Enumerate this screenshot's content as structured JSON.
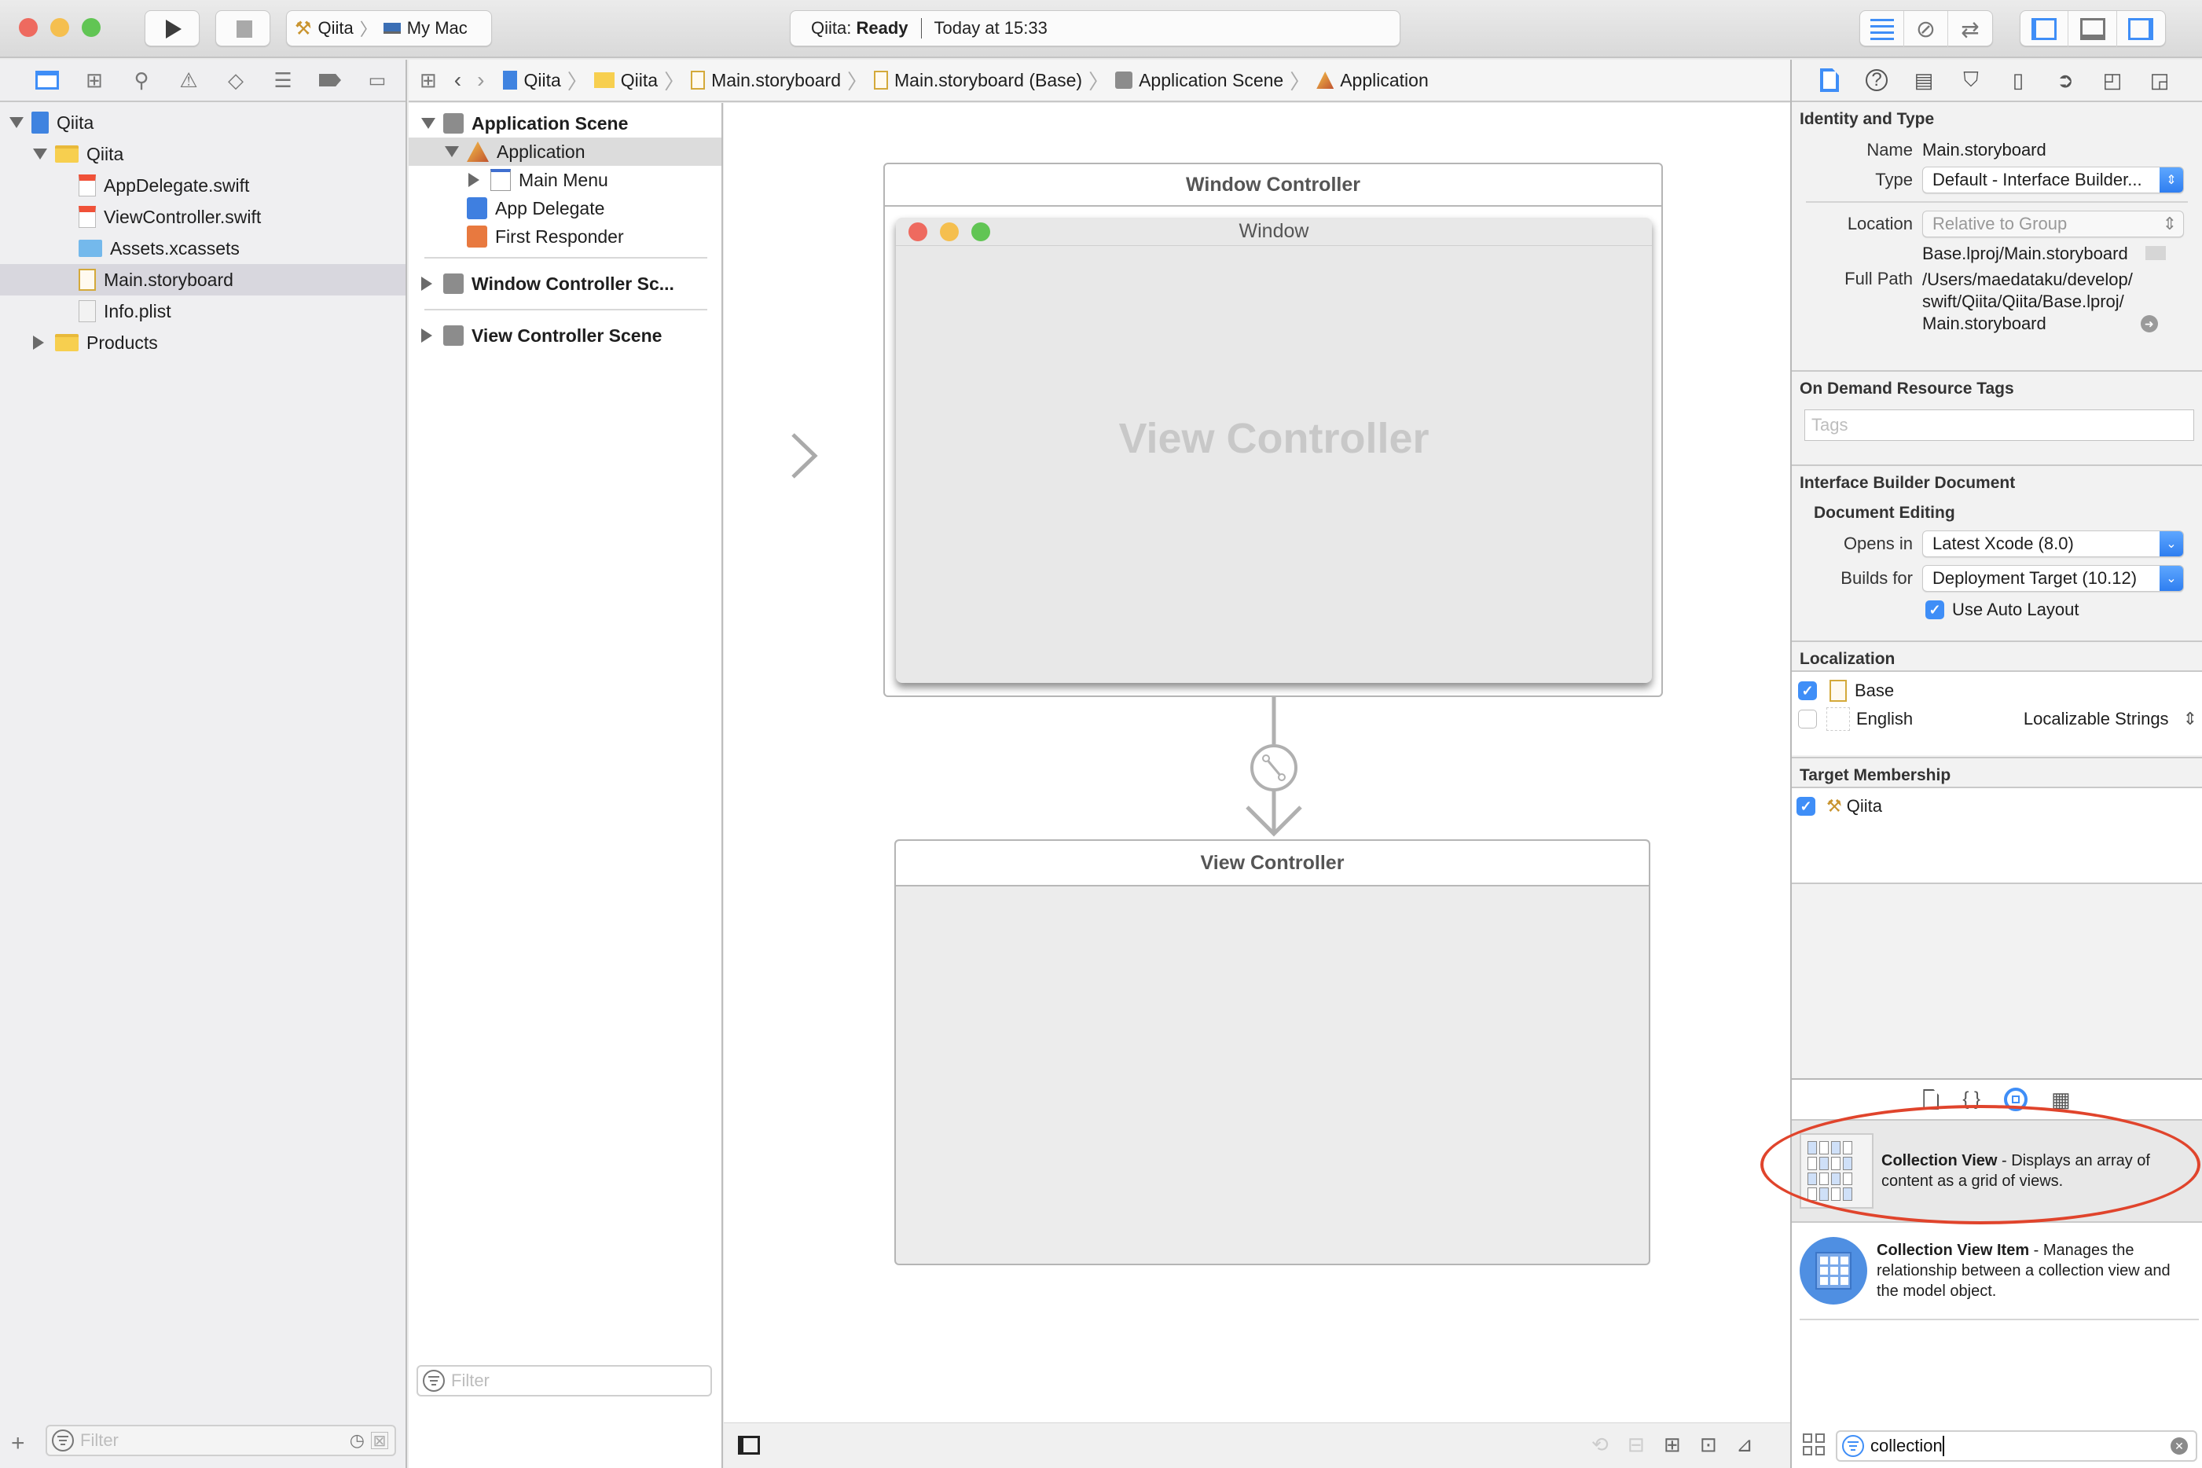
{
  "toolbar": {
    "run_icon": "play-icon",
    "stop_icon": "stop-icon",
    "scheme": {
      "project": "Qiita",
      "destination": "My Mac"
    },
    "status": {
      "project": "Qiita:",
      "state": "Ready",
      "time": "Today at 15:33"
    },
    "editor_modes": [
      "standard-editor-icon",
      "assistant-editor-icon",
      "version-editor-icon"
    ],
    "panel_toggles": [
      "navigator-toggle-icon",
      "debug-area-toggle-icon",
      "utilities-toggle-icon"
    ]
  },
  "navigator": {
    "tabs": [
      "project-navigator",
      "symbol-navigator",
      "find-navigator",
      "issue-navigator",
      "test-navigator",
      "debug-navigator",
      "breakpoint-navigator",
      "report-navigator"
    ],
    "tree": [
      {
        "label": "Qiita",
        "level": 0,
        "icon": "project-icon",
        "disclosure": "open"
      },
      {
        "label": "Qiita",
        "level": 1,
        "icon": "folder-icon",
        "disclosure": "open"
      },
      {
        "label": "AppDelegate.swift",
        "level": 2,
        "icon": "swift-file-icon"
      },
      {
        "label": "ViewController.swift",
        "level": 2,
        "icon": "swift-file-icon"
      },
      {
        "label": "Assets.xcassets",
        "level": 2,
        "icon": "asset-catalog-icon"
      },
      {
        "label": "Main.storyboard",
        "level": 2,
        "icon": "storyboard-icon",
        "selected": true
      },
      {
        "label": "Info.plist",
        "level": 2,
        "icon": "plist-icon"
      },
      {
        "label": "Products",
        "level": 1,
        "icon": "folder-icon",
        "disclosure": "closed"
      }
    ],
    "filter_placeholder": "Filter"
  },
  "jumpbar": {
    "crumbs": [
      "Qiita",
      "Qiita",
      "Main.storyboard",
      "Main.storyboard (Base)",
      "Application Scene",
      "Application"
    ]
  },
  "outline": {
    "items": [
      {
        "label": "Application Scene",
        "bold": true,
        "disclosure": "open"
      },
      {
        "label": "Application",
        "disclosure": "open",
        "selected": true
      },
      {
        "label": "Main Menu",
        "disclosure": "closed"
      },
      {
        "label": "App Delegate"
      },
      {
        "label": "First Responder"
      },
      {
        "label": "Window Controller Sc...",
        "bold": true,
        "disclosure": "closed"
      },
      {
        "label": "View Controller Scene",
        "bold": true,
        "disclosure": "closed"
      }
    ],
    "filter_placeholder": "Filter"
  },
  "canvas": {
    "window_controller": {
      "title": "Window Controller",
      "window_title": "Window",
      "content_label": "View Controller"
    },
    "view_controller": {
      "title": "View Controller"
    }
  },
  "inspector": {
    "identity": {
      "header": "Identity and Type",
      "name_label": "Name",
      "name": "Main.storyboard",
      "type_label": "Type",
      "type": "Default - Interface Builder...",
      "location_label": "Location",
      "location": "Relative to Group",
      "relative_path": "Base.lproj/Main.storyboard",
      "full_path_label": "Full Path",
      "full_path_lines": [
        "/Users/maedataku/develop/",
        "swift/Qiita/Qiita/Base.lproj/",
        "Main.storyboard"
      ]
    },
    "tags": {
      "header": "On Demand Resource Tags",
      "placeholder": "Tags"
    },
    "ib_document": {
      "header": "Interface Builder Document",
      "subheader": "Document Editing",
      "opens_in_label": "Opens in",
      "opens_in": "Latest Xcode (8.0)",
      "builds_for_label": "Builds for",
      "builds_for": "Deployment Target (10.12)",
      "auto_layout_label": "Use Auto Layout",
      "auto_layout": true
    },
    "localization": {
      "header": "Localization",
      "rows": [
        {
          "label": "Base",
          "checked": true
        },
        {
          "label": "English",
          "checked": false,
          "type": "Localizable Strings"
        }
      ]
    },
    "target_membership": {
      "header": "Target Membership",
      "rows": [
        {
          "label": "Qiita",
          "checked": true
        }
      ]
    }
  },
  "library": {
    "tabs": [
      "file-template-icon",
      "code-snippet-icon",
      "object-library-icon",
      "media-library-icon"
    ],
    "items": [
      {
        "title": "Collection View",
        "desc": " - Displays an array of content as a grid of views.",
        "selected": true,
        "highlighted": true
      },
      {
        "title": "Collection View Item",
        "desc": " - Manages the relationship between a collection view and the model object."
      }
    ],
    "search_value": "collection"
  },
  "colors": {
    "accent": "#3f8ef7",
    "annotation": "#e0442c",
    "close": "#ee6a5f",
    "minimize": "#f5bf4f",
    "zoom": "#61c554"
  }
}
